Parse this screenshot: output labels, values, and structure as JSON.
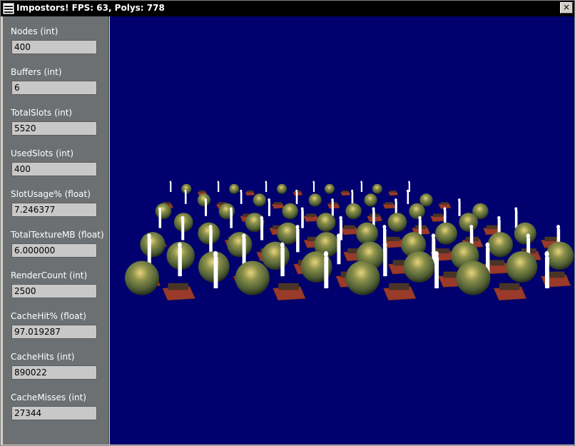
{
  "window": {
    "title": "Impostors! FPS: 63, Polys: 778"
  },
  "titlebar": {
    "close_label": "×",
    "icon": "window-app-icon"
  },
  "panel": {
    "fields": [
      {
        "label": "Nodes (int)",
        "value": "400"
      },
      {
        "label": "Buffers (int)",
        "value": "6"
      },
      {
        "label": "TotalSlots (int)",
        "value": "5520"
      },
      {
        "label": "UsedSlots (int)",
        "value": "400"
      },
      {
        "label": "SlotUsage% (float)",
        "value": "7.246377"
      },
      {
        "label": "TotalTextureMB (float)",
        "value": "6.000000"
      },
      {
        "label": "RenderCount (int)",
        "value": "2500"
      },
      {
        "label": "CacheHit% (float)",
        "value": "97.019287"
      },
      {
        "label": "CacheHits (int)",
        "value": "890022"
      },
      {
        "label": "CacheMisses (int)",
        "value": "27344"
      }
    ]
  },
  "colors": {
    "viewport_bg": "#00006e",
    "panel_bg": "#6d7073",
    "titlebar_bg": "#000000"
  }
}
